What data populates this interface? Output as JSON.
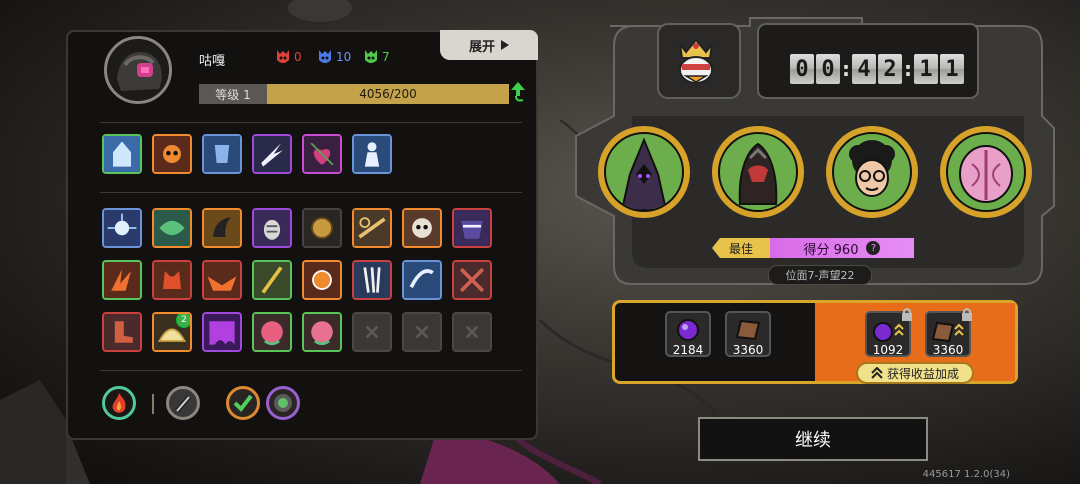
{
  "player": {
    "name": "咕嘎",
    "level_label": "等级 1",
    "xp_text": "4056/200",
    "xp_fraction": 1.0
  },
  "header": {
    "expand_label": "展开"
  },
  "resources": [
    {
      "icon": "red-mask-icon",
      "value": "0",
      "color": "#e0423a"
    },
    {
      "icon": "blue-mask-icon",
      "value": "10",
      "color": "#4d79e8"
    },
    {
      "icon": "green-mask-icon",
      "value": "7",
      "color": "#52c94a"
    }
  ],
  "skill_icons": [
    {
      "name": "ice-temple",
      "frame": "#59c45a"
    },
    {
      "name": "flame-skull",
      "frame": "#f28b2d"
    },
    {
      "name": "blue-armor",
      "frame": "#6b93d8"
    },
    {
      "name": "lightning-slash",
      "frame": "#a04adc"
    },
    {
      "name": "thorn-heart",
      "frame": "#c94bd6"
    },
    {
      "name": "ghost-figure",
      "frame": "#6b93d8"
    }
  ],
  "trinkets_row1": [
    {
      "name": "spark-ball",
      "frame": "#6b93d8"
    },
    {
      "name": "green-splash",
      "frame": "#f28b2d"
    },
    {
      "name": "gold-horn",
      "frame": "#f28b2d"
    },
    {
      "name": "purple-grenade",
      "frame": "#a04adc"
    },
    {
      "name": "gold-coin",
      "frame": "#444"
    },
    {
      "name": "whirl-beam",
      "frame": "#f28b2d"
    },
    {
      "name": "fire-skull",
      "frame": "#f28b2d"
    },
    {
      "name": "masked-face",
      "frame": "#c84040"
    }
  ],
  "trinkets_row2": [
    {
      "name": "fire-claw",
      "frame": "#59c45a"
    },
    {
      "name": "flame-cat",
      "frame": "#c84040"
    },
    {
      "name": "fire-bat",
      "frame": "#c84040"
    },
    {
      "name": "gold-lance",
      "frame": "#59c45a"
    },
    {
      "name": "fire-amulet",
      "frame": "#f28b2d"
    },
    {
      "name": "white-claws",
      "frame": "#c84040"
    },
    {
      "name": "blue-dash",
      "frame": "#6b93d8"
    },
    {
      "name": "crossed-swords",
      "frame": "#c84040"
    }
  ],
  "trinkets_row3": [
    {
      "name": "red-boot",
      "frame": "#c84040"
    },
    {
      "name": "golden-dome",
      "frame": "#f28b2d",
      "badge": "2"
    },
    {
      "name": "purple-slime",
      "frame": "#a04adc"
    },
    {
      "name": "pink-brain",
      "frame": "#59c45a"
    },
    {
      "name": "pink-brain-2",
      "frame": "#59c45a"
    }
  ],
  "timer": {
    "digits": [
      "0",
      "0",
      "4",
      "2",
      "1",
      "1"
    ]
  },
  "characters": [
    {
      "name": "dark-robed-figure"
    },
    {
      "name": "red-beast"
    },
    {
      "name": "afro-kid"
    },
    {
      "name": "pink-creature"
    }
  ],
  "score": {
    "best_label": "最佳",
    "score_label": "得分 960",
    "help": "?",
    "rank": "位面7-声望22"
  },
  "rewards": {
    "items": [
      {
        "icon": "purple-orb-icon",
        "value": "2184"
      },
      {
        "icon": "brown-card-icon",
        "value": "3360"
      }
    ],
    "bonus_items": [
      {
        "icon": "purple-orb-icon",
        "value": "1092"
      },
      {
        "icon": "brown-card-icon",
        "value": "3360"
      }
    ],
    "bonus_label": "获得收益加成"
  },
  "continue_label": "继续",
  "version": "445617 1.2.0(34)"
}
